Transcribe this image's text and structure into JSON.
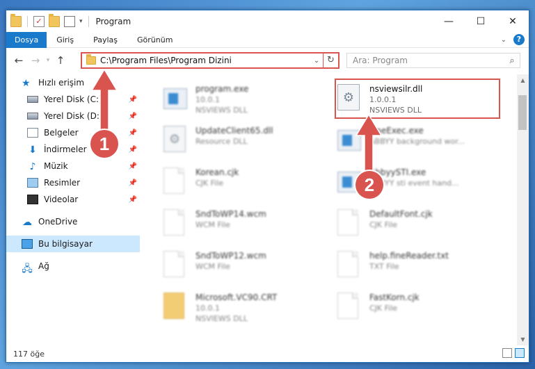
{
  "window": {
    "title": "Program",
    "buttons": {
      "minimize": "—",
      "maximize": "☐",
      "close": "✕"
    }
  },
  "ribbon": {
    "tabs": [
      "Dosya",
      "Giriş",
      "Paylaş",
      "Görünüm"
    ],
    "help": "?"
  },
  "navbar": {
    "address": "C:\\Program Files\\Program Dizini",
    "search_placeholder": "Ara: Program"
  },
  "sidebar": {
    "quick_access": "Hızlı erişim",
    "items": [
      {
        "label": "Yerel Disk (C:)",
        "icon": "disk-icon"
      },
      {
        "label": "Yerel Disk (D:)",
        "icon": "disk-icon"
      },
      {
        "label": "Belgeler",
        "icon": "documents-icon"
      },
      {
        "label": "İndirmeler",
        "icon": "download-icon"
      },
      {
        "label": "Müzik",
        "icon": "music-icon"
      },
      {
        "label": "Resimler",
        "icon": "pictures-icon"
      },
      {
        "label": "Videolar",
        "icon": "videos-icon"
      }
    ],
    "onedrive": "OneDrive",
    "this_pc": "Bu bilgisayar",
    "network": "Ağ"
  },
  "files": [
    {
      "name": "program.exe",
      "line1": "10.0.1",
      "line2": "NSVIEWS DLL",
      "icon": "exe",
      "col": 0,
      "row": 0,
      "blurred": true
    },
    {
      "name": "nsviewsilr.dll",
      "line1": "1.0.0.1",
      "line2": "NSVIEWS DLL",
      "icon": "dll",
      "col": 1,
      "row": 0,
      "blurred": false
    },
    {
      "name": "UpdateClient65.dll",
      "line1": "Resource DLL",
      "line2": "",
      "icon": "dll",
      "col": 0,
      "row": 1,
      "blurred": true
    },
    {
      "name": "FineExec.exe",
      "line1": "ABBYY background wor...",
      "line2": "",
      "icon": "exe",
      "col": 1,
      "row": 1,
      "blurred": true
    },
    {
      "name": "Korean.cjk",
      "line1": "CJK File",
      "line2": "",
      "icon": "page",
      "col": 0,
      "row": 2,
      "blurred": true
    },
    {
      "name": "AbbyySTI.exe",
      "line1": "ABBYY sti event hand...",
      "line2": "",
      "icon": "exe",
      "col": 1,
      "row": 2,
      "blurred": true
    },
    {
      "name": "SndToWP14.wcm",
      "line1": "WCM File",
      "line2": "",
      "icon": "page",
      "col": 0,
      "row": 3,
      "blurred": true
    },
    {
      "name": "DefaultFont.cjk",
      "line1": "CJK File",
      "line2": "",
      "icon": "page",
      "col": 1,
      "row": 3,
      "blurred": true
    },
    {
      "name": "SndToWP12.wcm",
      "line1": "WCM File",
      "line2": "",
      "icon": "page",
      "col": 0,
      "row": 4,
      "blurred": true
    },
    {
      "name": "help.fineReader.txt",
      "line1": "TXT File",
      "line2": "",
      "icon": "page",
      "col": 1,
      "row": 4,
      "blurred": true
    },
    {
      "name": "Microsoft.VC90.CRT",
      "line1": "10.0.1",
      "line2": "NSVIEWS DLL",
      "icon": "zip",
      "col": 0,
      "row": 5,
      "blurred": true
    },
    {
      "name": "FastKorn.cjk",
      "line1": "CJK File",
      "line2": "",
      "icon": "page",
      "col": 1,
      "row": 5,
      "blurred": true
    }
  ],
  "status": {
    "count": "117 öğe"
  },
  "annotations": {
    "step1": "1",
    "step2": "2",
    "color": "#d9534f"
  }
}
